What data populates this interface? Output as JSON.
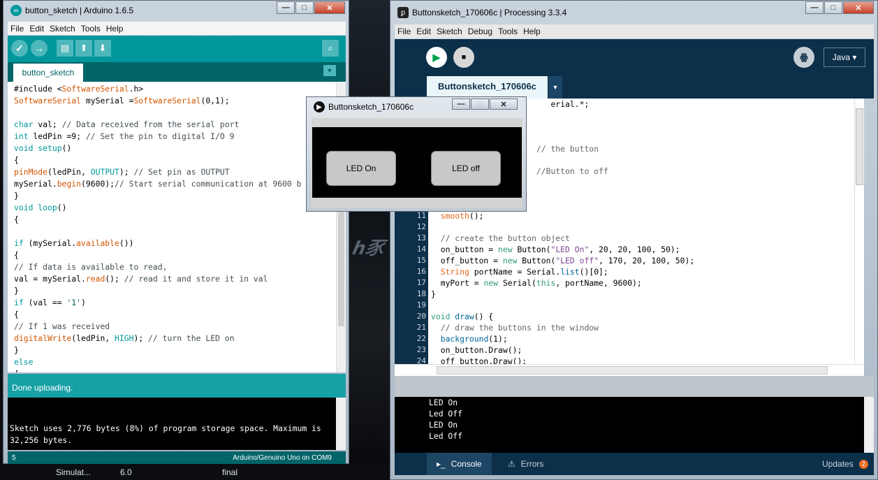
{
  "taskbar": {
    "items": [
      "Simulat...",
      "6.0",
      "final"
    ]
  },
  "arduino": {
    "title": "button_sketch | Arduino 1.6.5",
    "menu": [
      "File",
      "Edit",
      "Sketch",
      "Tools",
      "Help"
    ],
    "tab": "button_sketch",
    "code": [
      [
        [
          "",
          "#include <"
        ],
        [
          "fn",
          "SoftwareSerial"
        ],
        [
          "",
          ".h>"
        ]
      ],
      [
        [
          "fn",
          "SoftwareSerial"
        ],
        [
          "",
          " mySerial ="
        ],
        [
          "fn",
          "SoftwareSerial"
        ],
        [
          "",
          "(0,1);"
        ]
      ],
      [
        [
          "",
          ""
        ]
      ],
      [
        [
          "kw",
          "char"
        ],
        [
          "",
          " val; "
        ],
        [
          "cm",
          "// Data received from the serial port"
        ]
      ],
      [
        [
          "kw",
          "int"
        ],
        [
          "",
          " ledPin =9; "
        ],
        [
          "cm",
          "// Set the pin to digital I/O 9"
        ]
      ],
      [
        [
          "kw",
          "void"
        ],
        [
          "",
          " "
        ],
        [
          "kw",
          "setup"
        ],
        [
          "",
          "()"
        ]
      ],
      [
        [
          "",
          "{"
        ]
      ],
      [
        [
          "fn",
          "pinMode"
        ],
        [
          "",
          "(ledPin, "
        ],
        [
          "kw",
          "OUTPUT"
        ],
        [
          "",
          "); "
        ],
        [
          "cm",
          "// Set pin as OUTPUT"
        ]
      ],
      [
        [
          "",
          "mySerial."
        ],
        [
          "fn",
          "begin"
        ],
        [
          "",
          "(9600);"
        ],
        [
          "cm",
          "// Start serial communication at 9600 b"
        ]
      ],
      [
        [
          "",
          "}"
        ]
      ],
      [
        [
          "kw",
          "void"
        ],
        [
          "",
          " "
        ],
        [
          "kw",
          "loop"
        ],
        [
          "",
          "()"
        ]
      ],
      [
        [
          "",
          "{"
        ]
      ],
      [
        [
          "",
          ""
        ]
      ],
      [
        [
          "kw",
          "if"
        ],
        [
          "",
          " (mySerial."
        ],
        [
          "fn",
          "available"
        ],
        [
          "",
          "())"
        ]
      ],
      [
        [
          "",
          "{"
        ]
      ],
      [
        [
          "cm",
          "// If data is available to read,"
        ]
      ],
      [
        [
          "",
          "val = mySerial."
        ],
        [
          "fn",
          "read"
        ],
        [
          "",
          "(); "
        ],
        [
          "cm",
          "// read it and store it in val"
        ]
      ],
      [
        [
          "",
          "}"
        ]
      ],
      [
        [
          "kw",
          "if"
        ],
        [
          "",
          " (val == "
        ],
        [
          "st",
          "'1'"
        ],
        [
          "",
          ")"
        ]
      ],
      [
        [
          "",
          "{"
        ]
      ],
      [
        [
          "cm",
          "// If 1 was received"
        ]
      ],
      [
        [
          "fn",
          "digitalWrite"
        ],
        [
          "",
          "(ledPin, "
        ],
        [
          "kw",
          "HIGH"
        ],
        [
          "",
          "); "
        ],
        [
          "cm",
          "// turn the LED on"
        ]
      ],
      [
        [
          "",
          "}"
        ]
      ],
      [
        [
          "kw",
          "else"
        ]
      ],
      [
        [
          "",
          "{"
        ]
      ]
    ],
    "status": "Done uploading.",
    "console": "Sketch uses 2,776 bytes (8%) of program storage space. Maximum is 32,256 bytes.",
    "footer_line": "5",
    "footer_board": "Arduino/Genuino Uno on COM9"
  },
  "processing": {
    "title": "Buttonsketch_170606c | Processing 3.3.4",
    "menu": [
      "File",
      "Edit",
      "Sketch",
      "Debug",
      "Tools",
      "Help"
    ],
    "mode": "Java ▾",
    "tab": "Buttonsketch_170606c",
    "line_numbers": [
      "",
      "",
      "",
      "",
      "",
      "",
      "",
      "",
      "",
      "",
      "11",
      "12",
      "13",
      "14",
      "15",
      "16",
      "17",
      "18",
      "19",
      "20",
      "21",
      "22",
      "23",
      "24"
    ],
    "code": [
      [
        [
          "",
          "                         erial.*;"
        ]
      ],
      [
        [
          "",
          ""
        ]
      ],
      [
        [
          "",
          ""
        ]
      ],
      [
        [
          "",
          ""
        ]
      ],
      [
        [
          "",
          "                      "
        ],
        [
          "pm",
          "// the button"
        ]
      ],
      [
        [
          "",
          ""
        ]
      ],
      [
        [
          "",
          "                      "
        ],
        [
          "pm",
          "//Button to off"
        ]
      ],
      [
        [
          "",
          ""
        ]
      ],
      [
        [
          "",
          ""
        ]
      ],
      [
        [
          "",
          ""
        ]
      ],
      [
        [
          "",
          "  "
        ],
        [
          "pc",
          "smooth"
        ],
        [
          "",
          "();"
        ]
      ],
      [
        [
          "",
          ""
        ]
      ],
      [
        [
          "",
          "  "
        ],
        [
          "pm",
          "// create the button object"
        ]
      ],
      [
        [
          "",
          "  on_button = "
        ],
        [
          "pk",
          "new"
        ],
        [
          "",
          " Button("
        ],
        [
          "ps",
          "\"LED On\""
        ],
        [
          "",
          ", 20, 20, 100, 50);"
        ]
      ],
      [
        [
          "",
          "  off_button = "
        ],
        [
          "pk",
          "new"
        ],
        [
          "",
          " Button("
        ],
        [
          "ps",
          "\"LED off\""
        ],
        [
          "",
          ", 170, 20, 100, 50);"
        ]
      ],
      [
        [
          "",
          "  "
        ],
        [
          "pc",
          "String"
        ],
        [
          "",
          " portName = Serial."
        ],
        [
          "pf",
          "list"
        ],
        [
          "",
          "()[0];"
        ]
      ],
      [
        [
          "",
          "  myPort = "
        ],
        [
          "pk",
          "new"
        ],
        [
          "",
          " Serial("
        ],
        [
          "pk",
          "this"
        ],
        [
          "",
          ", portName, 9600);"
        ]
      ],
      [
        [
          "",
          "}"
        ]
      ],
      [
        [
          "",
          ""
        ]
      ],
      [
        [
          "pk",
          "void"
        ],
        [
          "",
          " "
        ],
        [
          "pf",
          "draw"
        ],
        [
          "",
          "() {"
        ]
      ],
      [
        [
          "",
          "  "
        ],
        [
          "pm",
          "// draw the buttons in the window"
        ]
      ],
      [
        [
          "",
          "  "
        ],
        [
          "pf",
          "background"
        ],
        [
          "",
          "(1);"
        ]
      ],
      [
        [
          "",
          "  on_button.Draw();"
        ]
      ],
      [
        [
          "",
          "  off_button.Draw();"
        ]
      ]
    ],
    "console": [
      "LED On",
      "Led Off",
      "LED On",
      "Led Off"
    ],
    "bottom_tabs": {
      "console": "Console",
      "errors": "Errors",
      "updates": "Updates",
      "updates_count": "2"
    }
  },
  "sketch": {
    "title": "Buttonsketch_170606c",
    "btn_on": "LED On",
    "btn_off": "LED off"
  },
  "icons": {
    "arduino": "infinity-logo-icon",
    "processing": "processing-logo-icon"
  },
  "colors": {
    "arduino_teal": "#00979c",
    "processing_navy": "#0c2f4a"
  }
}
